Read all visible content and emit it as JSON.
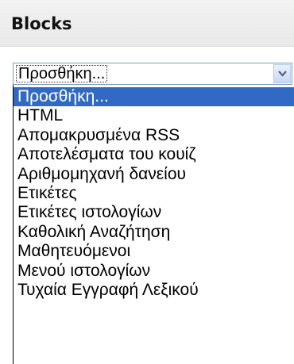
{
  "block": {
    "title": "Blocks"
  },
  "select": {
    "value": "Προσθήκη...",
    "options": [
      "Προσθήκη...",
      "HTML",
      "Απομακρυσμένα RSS",
      "Αποτελέσματα του κουίζ",
      "Αριθμομηχανή δανείου",
      "Ετικέτες",
      "Ετικέτες ιστολογίων",
      "Καθολική Αναζήτηση",
      "Μαθητευόμενοι",
      "Μενού ιστολογίων",
      "Τυχαία Εγγραφή Λεξικού"
    ],
    "selected_index": 0
  },
  "colors": {
    "highlight": "#316ac5",
    "border": "#7f9db9",
    "header_bg": "#eeeeee"
  },
  "icons": {
    "dropdown_arrow": "chevron-down-icon"
  }
}
